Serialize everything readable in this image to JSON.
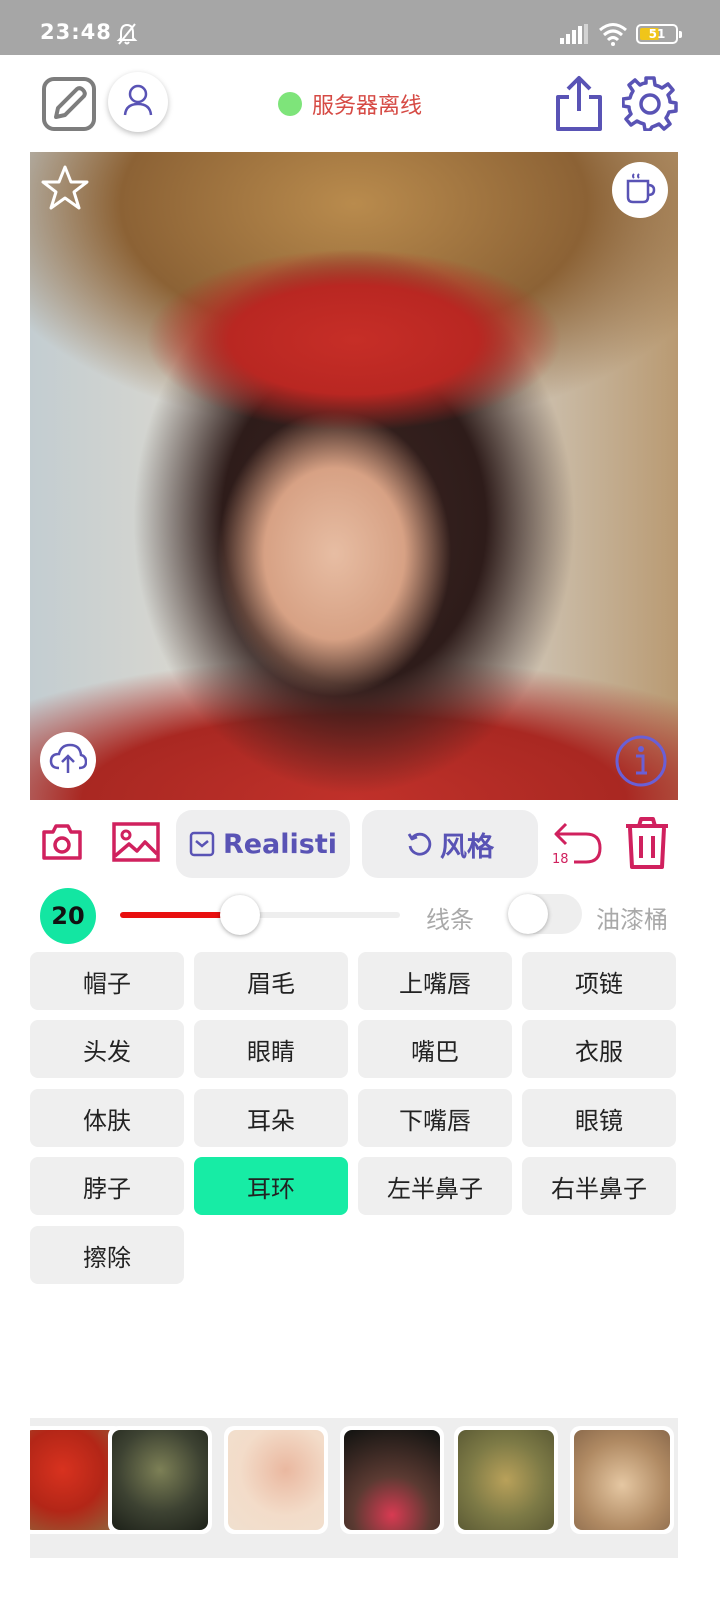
{
  "status_bar": {
    "time": "23:48",
    "battery": "51",
    "icons": [
      "bell-muted-icon",
      "signal-icon",
      "wifi-icon",
      "battery-icon"
    ]
  },
  "header": {
    "server_status_text": "服务器离线",
    "server_status_color": "#7ee47a",
    "icons": [
      "edit-icon",
      "user-icon",
      "share-icon",
      "settings-icon"
    ]
  },
  "canvas": {
    "icons": [
      "star-icon",
      "coffee-cup-icon",
      "upload-cloud-icon",
      "info-icon"
    ]
  },
  "toolbar": {
    "model_label": "Realisti",
    "style_label": "风格",
    "undo_count": "18",
    "icons": [
      "camera-icon",
      "image-icon",
      "undo-icon",
      "trash-icon"
    ]
  },
  "brush": {
    "size": "20",
    "slider_fraction": 0.43,
    "lines_label": "线条",
    "bucket_label": "油漆桶",
    "bucket_enabled": false
  },
  "parts": [
    {
      "label": "帽子",
      "active": false
    },
    {
      "label": "眉毛",
      "active": false
    },
    {
      "label": "上嘴唇",
      "active": false
    },
    {
      "label": "项链",
      "active": false
    },
    {
      "label": "头发",
      "active": false
    },
    {
      "label": "眼睛",
      "active": false
    },
    {
      "label": "嘴巴",
      "active": false
    },
    {
      "label": "衣服",
      "active": false
    },
    {
      "label": "体肤",
      "active": false
    },
    {
      "label": "耳朵",
      "active": false
    },
    {
      "label": "下嘴唇",
      "active": false
    },
    {
      "label": "眼镜",
      "active": false
    },
    {
      "label": "脖子",
      "active": false
    },
    {
      "label": "耳环",
      "active": true
    },
    {
      "label": "左半鼻子",
      "active": false
    },
    {
      "label": "右半鼻子",
      "active": false
    },
    {
      "label": "擦除",
      "active": false
    }
  ],
  "colors": {
    "accent": "#5953b5",
    "accent_red": "#d0215e",
    "active_part": "#17eca5",
    "slider_fill": "#e80f0f"
  }
}
